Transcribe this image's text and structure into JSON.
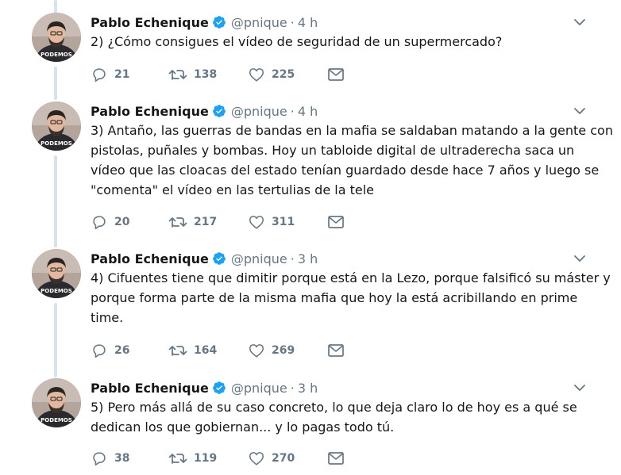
{
  "colors": {
    "text": "#14171a",
    "secondary": "#657786",
    "verified": "#1da1f2",
    "thread_line": "#d6e3ec"
  },
  "tweets": [
    {
      "name": "Pablo Echenique",
      "handle": "@pnique",
      "dot": "·",
      "time": "4 h",
      "avatar_badge": "PODEMOS",
      "lines": [
        "2) ¿Cómo consigues el vídeo de seguridad de un supermercado?"
      ],
      "replies": "21",
      "retweets": "138",
      "likes": "225"
    },
    {
      "name": "Pablo Echenique",
      "handle": "@pnique",
      "dot": "·",
      "time": "4 h",
      "avatar_badge": "PODEMOS",
      "lines": [
        "3) Antaño, las guerras de bandas en la mafia se saldaban matando a la gente con",
        "pistolas, puñales y bombas. Hoy un tabloide digital de ultraderecha saca un",
        "vídeo que las cloacas del estado tenían guardado desde hace 7 años y luego se",
        "\"comenta\" el vídeo en las tertulias de la tele"
      ],
      "replies": "20",
      "retweets": "217",
      "likes": "311"
    },
    {
      "name": "Pablo Echenique",
      "handle": "@pnique",
      "dot": "·",
      "time": "3 h",
      "avatar_badge": "PODEMOS",
      "lines": [
        "4) Cifuentes tiene que dimitir porque está en la Lezo, porque falsificó su máster y",
        "porque forma parte de la misma mafia que hoy la está acribillando en prime",
        "time."
      ],
      "replies": "26",
      "retweets": "164",
      "likes": "269"
    },
    {
      "name": "Pablo Echenique",
      "handle": "@pnique",
      "dot": "·",
      "time": "3 h",
      "avatar_badge": "PODEMOS",
      "lines": [
        "5) Pero más allá de su caso concreto, lo que deja claro lo de hoy es a qué se",
        "dedican los que gobiernan... y lo pagas todo tú."
      ],
      "replies": "38",
      "retweets": "119",
      "likes": "270"
    }
  ]
}
